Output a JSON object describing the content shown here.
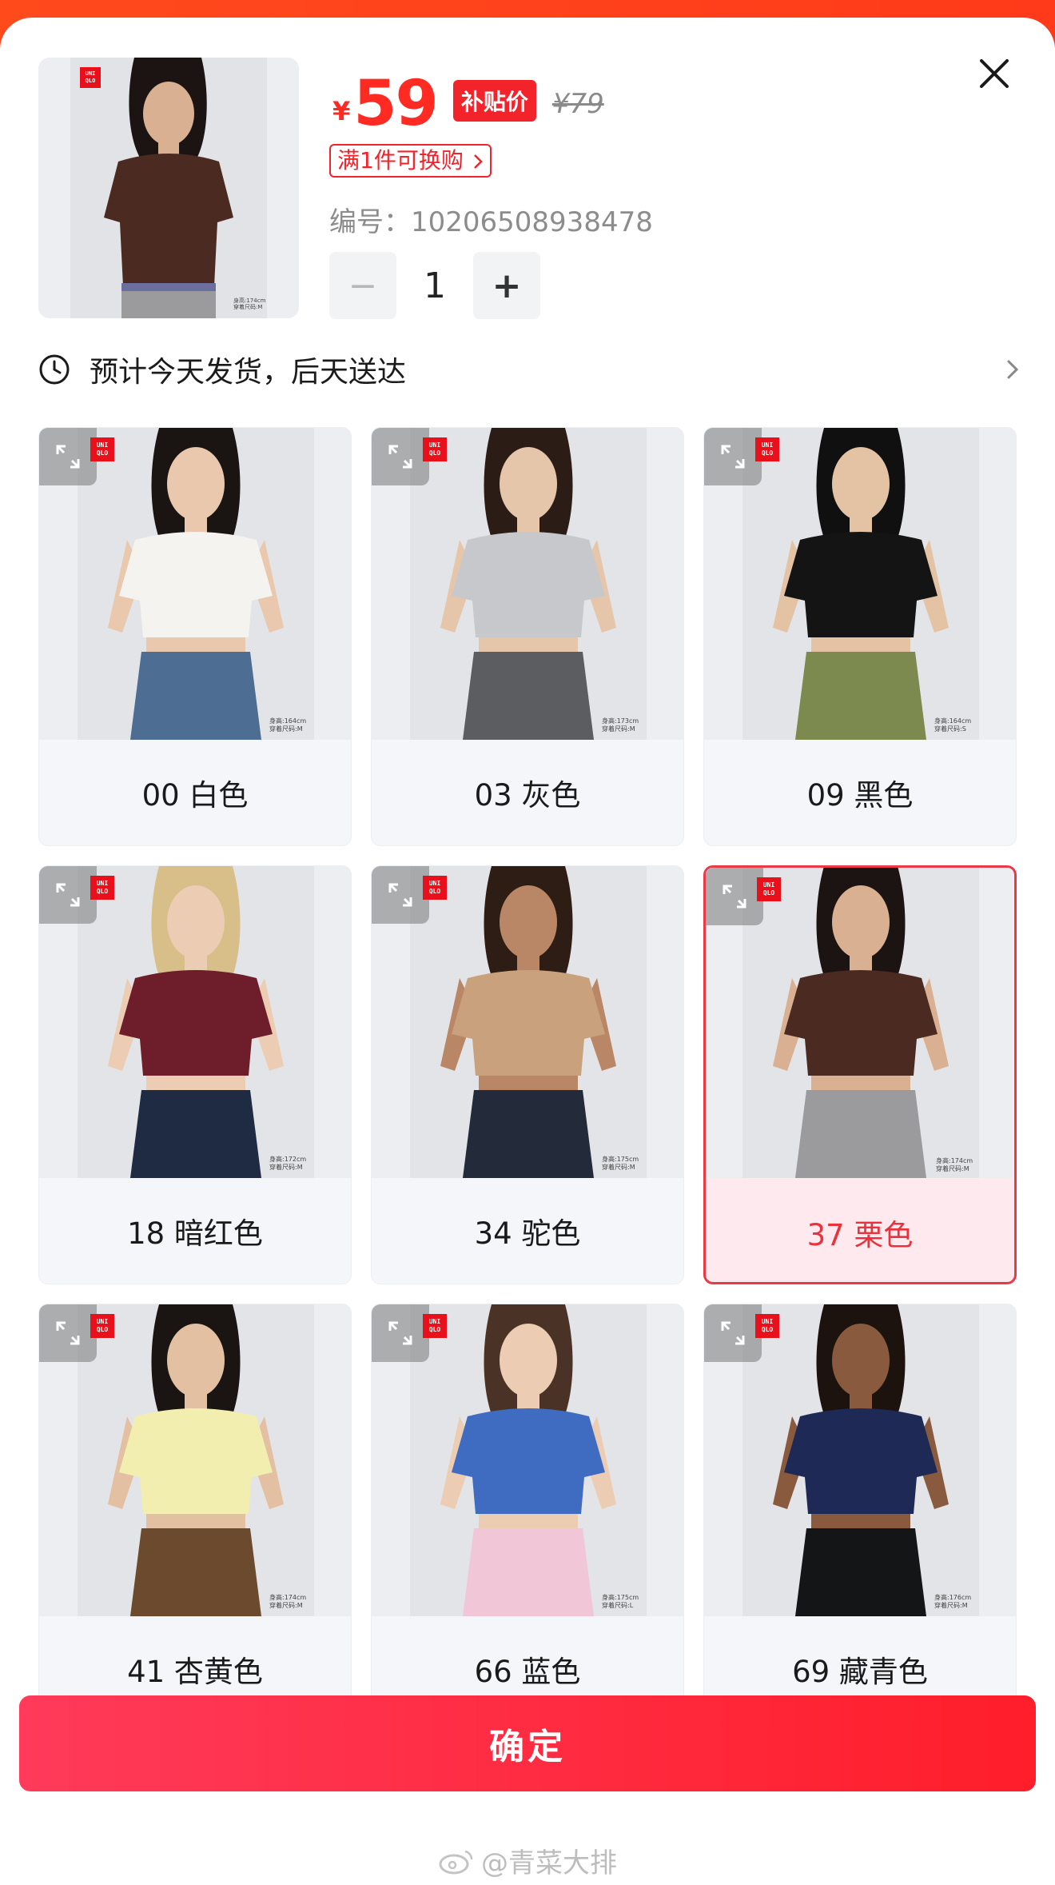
{
  "product": {
    "currency": "¥",
    "price": "59",
    "subsidy_badge": "补贴价",
    "original_price": "¥79",
    "promo": "满1件可换购",
    "sku_label": "编号：",
    "sku_value": "10206508938478",
    "quantity": "1",
    "minus": "−",
    "plus": "+"
  },
  "delivery": {
    "text": "预计今天发货，后天送达"
  },
  "variants": [
    {
      "label": "00 白色",
      "shirt": "#f4f3ef",
      "bottom": "#4d6d93",
      "skin": "#e9c8ad",
      "hair": "#1a1513",
      "tag1": "身高:164cm",
      "tag2": "穿着尺码:M"
    },
    {
      "label": "03 灰色",
      "shirt": "#c6c8cb",
      "bottom": "#5c5d61",
      "skin": "#e6c6ab",
      "hair": "#2b1d16",
      "tag1": "身高:173cm",
      "tag2": "穿着尺码:M"
    },
    {
      "label": "09 黑色",
      "shirt": "#141414",
      "bottom": "#7c8a4f",
      "skin": "#e4c2a4",
      "hair": "#111010",
      "tag1": "身高:164cm",
      "tag2": "穿着尺码:S"
    },
    {
      "label": "18 暗红色",
      "shirt": "#6e1d2a",
      "bottom": "#1f2a43",
      "skin": "#ecccb3",
      "hair": "#d8bf8a",
      "tag1": "身高:172cm",
      "tag2": "穿着尺码:M"
    },
    {
      "label": "34 驼色",
      "shirt": "#c9a27d",
      "bottom": "#232a3a",
      "skin": "#b98765",
      "hair": "#2e1d14",
      "tag1": "身高:175cm",
      "tag2": "穿着尺码:M"
    },
    {
      "label": "37 栗色",
      "shirt": "#4b2a22",
      "bottom": "#9b9a9c",
      "skin": "#d9b091",
      "hair": "#1b1412",
      "tag1": "身高:174cm",
      "tag2": "穿着尺码:M",
      "selected": true
    },
    {
      "label": "41 杏黄色",
      "shirt": "#f1eeb0",
      "bottom": "#6c4a2e",
      "skin": "#e3c0a2",
      "hair": "#1a1512",
      "tag1": "身高:174cm",
      "tag2": "穿着尺码:M"
    },
    {
      "label": "66 蓝色",
      "shirt": "#3f6cc0",
      "bottom": "#f1c6d6",
      "skin": "#ecccb2",
      "hair": "#4a3326",
      "tag1": "身高:175cm",
      "tag2": "穿着尺码:L"
    },
    {
      "label": "69 藏青色",
      "shirt": "#1e2a55",
      "bottom": "#141517",
      "skin": "#8a5a3e",
      "hair": "#1c130e",
      "tag1": "身高:176cm",
      "tag2": "穿着尺码:M"
    }
  ],
  "brand_logo": "UNI QLO",
  "thumb_tag1": "身高:174cm",
  "thumb_tag2": "穿着尺码:M",
  "confirm_button": "确定",
  "watermark": "@青菜大排",
  "icons": {
    "close": "close-icon",
    "clock": "clock-icon",
    "chevron": "chevron-right-icon",
    "expand": "expand-icon"
  },
  "colors": {
    "accent": "#ff2a22",
    "selected_border": "#ea3a45",
    "confirm_gradient_start": "#ff3a5a",
    "confirm_gradient_end": "#ff1e2a"
  }
}
